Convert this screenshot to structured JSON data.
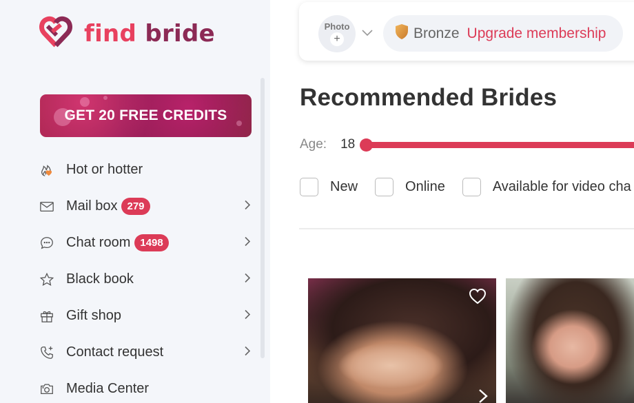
{
  "brand": {
    "name_part1": "find",
    "name_part2": "bride",
    "primary_color": "#e8415f",
    "secondary_color": "#8c2a55"
  },
  "sidebar": {
    "promo_button": "GET 20 FREE CREDITS",
    "items": [
      {
        "label": "Hot or hotter",
        "icon": "flame-heart-icon",
        "badge": null,
        "has_chevron": false
      },
      {
        "label": "Mail box",
        "icon": "envelope-icon",
        "badge": "279",
        "has_chevron": true
      },
      {
        "label": "Chat room",
        "icon": "chat-bubble-icon",
        "badge": "1498",
        "has_chevron": true
      },
      {
        "label": "Black book",
        "icon": "star-icon",
        "badge": null,
        "has_chevron": true
      },
      {
        "label": "Gift shop",
        "icon": "gift-icon",
        "badge": null,
        "has_chevron": true
      },
      {
        "label": "Contact request",
        "icon": "phone-plus-icon",
        "badge": null,
        "has_chevron": true
      },
      {
        "label": "Media Center",
        "icon": "camera-icon",
        "badge": null,
        "has_chevron": false
      }
    ]
  },
  "header": {
    "photo_label": "Photo",
    "photo_add": "+",
    "membership_level": "Bronze",
    "upgrade_label": "Upgrade membership",
    "bronze_color": "#d9963a",
    "accent_color": "#dc3b57"
  },
  "main": {
    "title": "Recommended Brides",
    "age_label": "Age:",
    "age_min": "18",
    "filters": [
      {
        "label": "New",
        "checked": false
      },
      {
        "label": "Online",
        "checked": false
      },
      {
        "label": "Available for video cha",
        "checked": false
      }
    ],
    "cards": [
      {
        "favorite": false
      },
      {
        "favorite": false
      }
    ]
  }
}
